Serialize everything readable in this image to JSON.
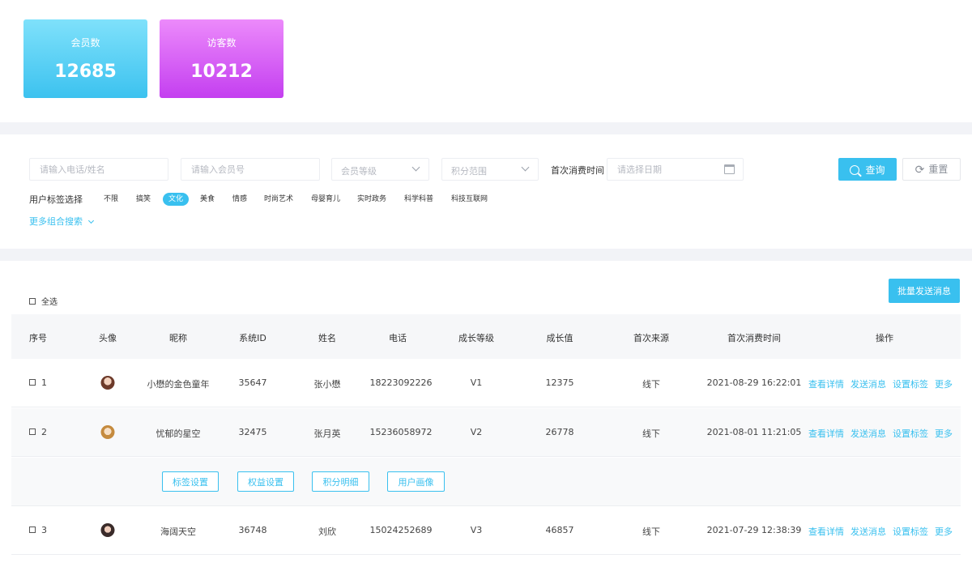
{
  "stats": {
    "members": {
      "label": "会员数",
      "value": "12685"
    },
    "visitors": {
      "label": "访客数",
      "value": "10212"
    }
  },
  "filters": {
    "phone_name_placeholder": "请输入电话/姓名",
    "member_no_placeholder": "请输入会员号",
    "level_placeholder": "会员等级",
    "points_placeholder": "积分范围",
    "first_purchase_label": "首次消费时间",
    "date_placeholder": "请选择日期",
    "query_label": "查询",
    "reset_label": "重置",
    "tag_select_label": "用户标签选择",
    "tags": [
      "不限",
      "搞笑",
      "文化",
      "美食",
      "情感",
      "时尚艺术",
      "母婴育儿",
      "实时政务",
      "科学科普",
      "科技互联网"
    ],
    "active_tag": "文化",
    "more_search_label": "更多组合搜索"
  },
  "table": {
    "batch_button": "批量发送消息",
    "select_all": "全选",
    "headers": [
      "序号",
      "头像",
      "昵称",
      "系统ID",
      "姓名",
      "电话",
      "成长等级",
      "成长值",
      "首次来源",
      "首次消费时间",
      "操作"
    ],
    "rows": [
      {
        "no": "1",
        "nickname": "小懋的金色童年",
        "id": "35647",
        "name": "张小懋",
        "phone": "18223092226",
        "level": "V1",
        "growth": "12375",
        "source": "线下",
        "time": "2021-08-29 16:22:01"
      },
      {
        "no": "2",
        "nickname": "忧郁的星空",
        "id": "32475",
        "name": "张月英",
        "phone": "15236058972",
        "level": "V2",
        "growth": "26778",
        "source": "线下",
        "time": "2021-08-01 11:21:05"
      },
      {
        "no": "3",
        "nickname": "海阔天空",
        "id": "36748",
        "name": "刘欣",
        "phone": "15024252689",
        "level": "V3",
        "growth": "46857",
        "source": "线下",
        "time": "2021-07-29 12:38:39"
      }
    ],
    "actions": [
      "查看详情",
      "发送消息",
      "设置标签",
      "更多"
    ],
    "expand_buttons": [
      "标签设置",
      "权益设置",
      "积分明细",
      "用户画像"
    ]
  },
  "colors": {
    "accent": "#39c0ef",
    "member_card": "#3cc2ef",
    "visitor_card": "#c43ff0"
  }
}
